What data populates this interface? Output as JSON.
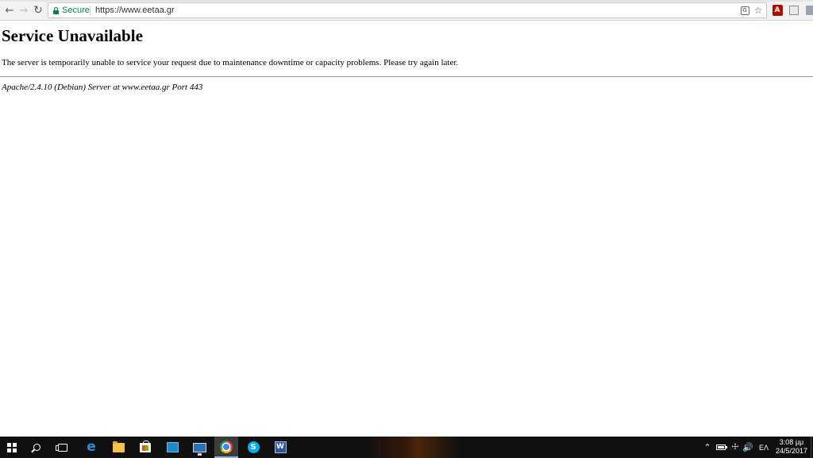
{
  "browser": {
    "security_label": "Secure",
    "url": "https://www.eetaa.gr",
    "icons": {
      "back": "arrow-left",
      "forward": "arrow-right",
      "reload": "reload",
      "translate": "translate",
      "bookmark": "star",
      "extensions": [
        "adobe-pdf",
        "window-extension",
        "save-extension"
      ]
    }
  },
  "page": {
    "title": "Service Unavailable",
    "message": "The server is temporarily unable to service your request due to maintenance downtime or capacity problems. Please try again later.",
    "server_signature": "Apache/2.4.10 (Debian) Server at www.eetaa.gr Port 443"
  },
  "taskbar": {
    "pinned_apps": [
      "start",
      "search",
      "task-view",
      "edge",
      "file-explorer",
      "store",
      "app",
      "app",
      "chrome",
      "skype",
      "word"
    ],
    "active_app": "chrome",
    "tray": {
      "language": "EΛ",
      "time": "3:08 μμ",
      "date": "24/5/2017"
    }
  }
}
